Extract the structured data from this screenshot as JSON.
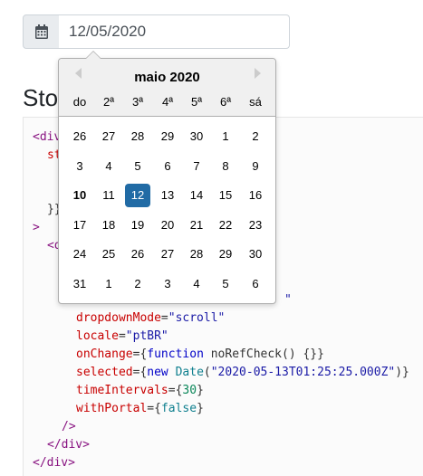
{
  "date_input": {
    "value": "12/05/2020",
    "icon": "calendar-icon"
  },
  "heading": "Sto",
  "datepicker": {
    "month_title": "maio 2020",
    "weekdays": [
      "do",
      "2ª",
      "3ª",
      "4ª",
      "5ª",
      "6ª",
      "sá"
    ],
    "weeks": [
      [
        "26",
        "27",
        "28",
        "29",
        "30",
        "1",
        "2"
      ],
      [
        "3",
        "4",
        "5",
        "6",
        "7",
        "8",
        "9"
      ],
      [
        "10",
        "11",
        "12",
        "13",
        "14",
        "15",
        "16"
      ],
      [
        "17",
        "18",
        "19",
        "20",
        "21",
        "22",
        "23"
      ],
      [
        "24",
        "25",
        "26",
        "27",
        "28",
        "29",
        "30"
      ],
      [
        "31",
        "1",
        "2",
        "3",
        "4",
        "5",
        "6"
      ]
    ],
    "today": "10",
    "selected": "12",
    "selected_color": "#216ba5"
  },
  "code": {
    "l1_tag": "<div",
    "l2": "st",
    "l3": "}}",
    "l4": ">",
    "l5": "<d",
    "l6_str": "\"",
    "l7_attr": "dropdownMode",
    "l7_eq": "=",
    "l7_val": "\"scroll\"",
    "l8_attr": "locale",
    "l8_eq": "=",
    "l8_val": "\"ptBR\"",
    "l9_attr": "onChange",
    "l9_eq": "={",
    "l9_kw": "function",
    "l9_rest": " noRefCheck() {}}",
    "l10_attr": "selected",
    "l10_eq": "={",
    "l10_kw": "new",
    "l10_sp": " ",
    "l10_cls": "Date",
    "l10_p1": "(",
    "l10_str": "\"2020-05-13T01:25:25.000Z\"",
    "l10_p2": ")}",
    "l11_attr": "timeIntervals",
    "l11_eq": "={",
    "l11_num": "30",
    "l11_end": "}",
    "l12_attr": "withPortal",
    "l12_eq": "={",
    "l12_bool": "false",
    "l12_end": "}",
    "l13": "/>",
    "l14": "</div>",
    "l15": "</div>"
  }
}
